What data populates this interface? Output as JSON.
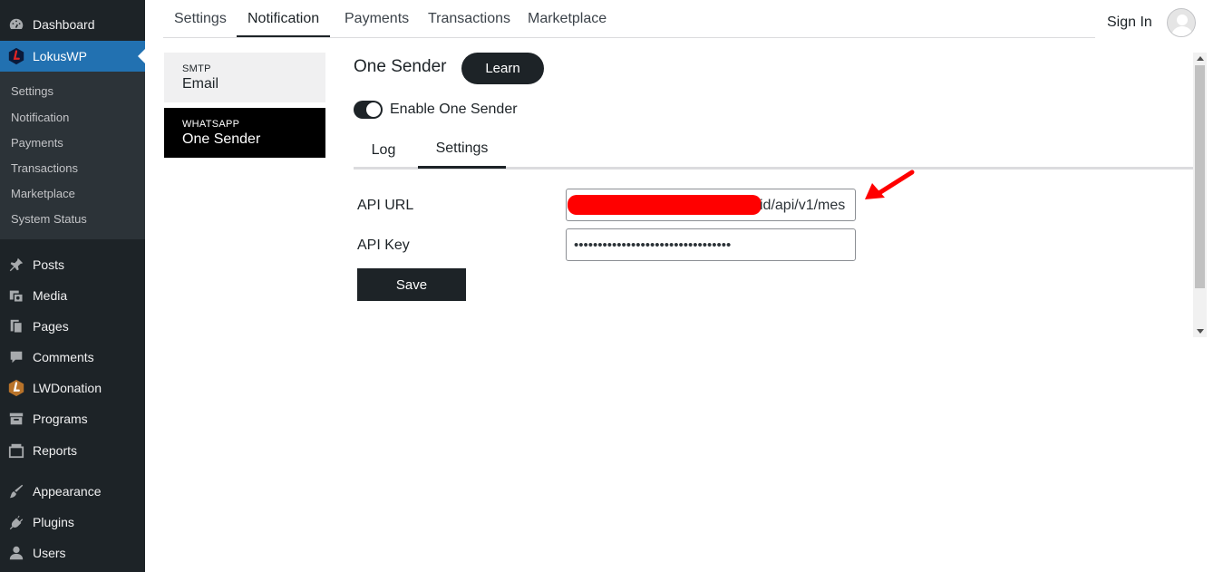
{
  "sidebar": {
    "items": [
      {
        "label": "Dashboard",
        "icon": "dashboard-icon"
      },
      {
        "label": "LokusWP",
        "icon": "lokuswp-logo-icon"
      },
      {
        "label": "Posts",
        "icon": "pin-icon"
      },
      {
        "label": "Media",
        "icon": "media-icon"
      },
      {
        "label": "Pages",
        "icon": "pages-icon"
      },
      {
        "label": "Comments",
        "icon": "comment-icon"
      },
      {
        "label": "LWDonation",
        "icon": "lwdonation-logo-icon"
      },
      {
        "label": "Programs",
        "icon": "archive-icon"
      },
      {
        "label": "Reports",
        "icon": "reports-icon"
      },
      {
        "label": "Appearance",
        "icon": "brush-icon"
      },
      {
        "label": "Plugins",
        "icon": "plug-icon"
      },
      {
        "label": "Users",
        "icon": "user-icon"
      }
    ],
    "submenu": [
      "Settings",
      "Notification",
      "Payments",
      "Transactions",
      "Marketplace",
      "System Status"
    ]
  },
  "topnav": {
    "tabs": [
      "Settings",
      "Notification",
      "Payments",
      "Transactions",
      "Marketplace"
    ],
    "active": "Notification",
    "signin": "Sign In"
  },
  "channels": [
    {
      "kind": "SMTP",
      "name": "Email"
    },
    {
      "kind": "WHATSAPP",
      "name": "One Sender"
    }
  ],
  "panel": {
    "title": "One Sender",
    "learn": "Learn",
    "toggle_label": "Enable One Sender",
    "subtabs": [
      "Log",
      "Settings"
    ],
    "api_url_label": "API URL",
    "api_url_visible": "id/api/v1/mes",
    "api_key_label": "API Key",
    "api_key_value": "•••••••••••••••••••••••••••••••••",
    "save": "Save"
  },
  "colors": {
    "accent": "#2271b1",
    "sidebar": "#1d2327",
    "redaction": "#ff0000"
  }
}
